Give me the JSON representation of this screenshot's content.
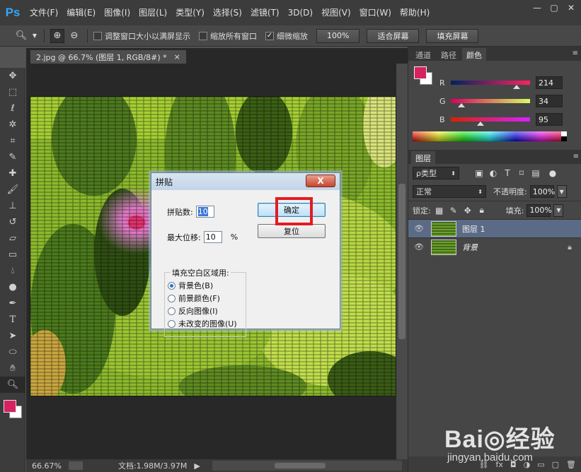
{
  "app": {
    "logo": "Ps"
  },
  "menu": [
    "文件(F)",
    "编辑(E)",
    "图像(I)",
    "图层(L)",
    "类型(Y)",
    "选择(S)",
    "滤镜(T)",
    "3D(D)",
    "视图(V)",
    "窗口(W)",
    "帮助(H)"
  ],
  "window_controls": {
    "minimize": "—",
    "restore": "▢",
    "close": "✕"
  },
  "options": {
    "resize_windows": "调整窗口大小以满屏显示",
    "zoom_all": "缩放所有窗口",
    "scrubby_zoom": "细微缩放",
    "btn_100": "100%",
    "btn_fit": "适合屏幕",
    "btn_fill": "填充屏幕"
  },
  "document": {
    "tab_title": "2.jpg @ 66.7% (图层 1, RGB/8#) *",
    "tab_close": "×",
    "zoom": "66.67%",
    "doc_info": "文档:1.98M/3.97M"
  },
  "color_panel": {
    "tabs": [
      "通道",
      "路径",
      "颜色"
    ],
    "active_tab": "颜色",
    "r_label": "R",
    "r_value": "214",
    "g_label": "G",
    "g_value": "34",
    "b_label": "B",
    "b_value": "95",
    "foreground": "#d62260",
    "background": "#ffffff"
  },
  "layers_panel": {
    "tab": "图层",
    "filter_kind": "ρ类型",
    "blend_mode": "正常",
    "opacity_label": "不透明度:",
    "opacity_value": "100%",
    "lock_label": "锁定:",
    "fill_label": "填充:",
    "fill_value": "100%",
    "layers": [
      {
        "name": "图层 1",
        "selected": true
      },
      {
        "name": "背景",
        "selected": false,
        "locked": true
      }
    ]
  },
  "dialog": {
    "title": "拼贴",
    "close": "X",
    "tiles_label": "拼贴数:",
    "tiles_value": "10",
    "offset_label": "最大位移:",
    "offset_value": "10",
    "offset_unit": "%",
    "ok": "确定",
    "reset": "复位",
    "fill_group": "填充空白区域用:",
    "fill_options": [
      "背景色(B)",
      "前景颜色(F)",
      "反向图像(I)",
      "未改变的图像(U)"
    ],
    "fill_selected": 0
  },
  "watermark": {
    "main": "Bai◎经验",
    "sub": "jingyan.baidu.com"
  }
}
